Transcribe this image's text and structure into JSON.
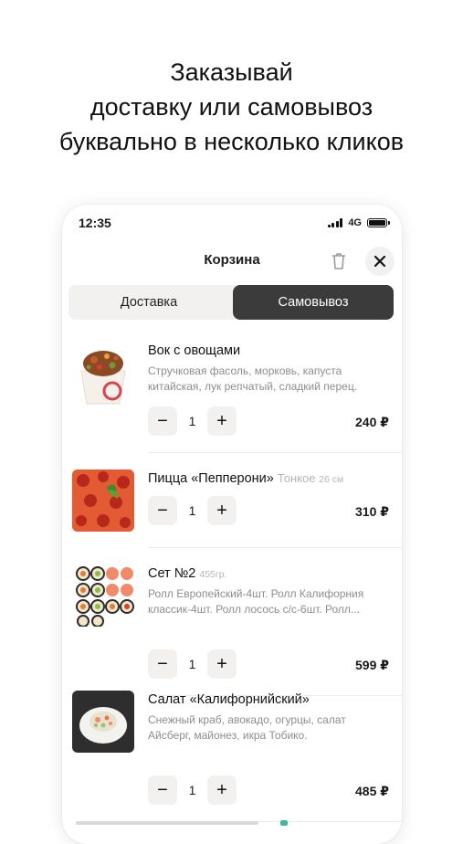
{
  "promo": {
    "line1": "Заказывай",
    "line2": "доставку или самовывоз",
    "line3": "буквально в несколько кликов"
  },
  "status_bar": {
    "time": "12:35",
    "network": "4G"
  },
  "header": {
    "title": "Корзина",
    "icons": [
      "trash-icon",
      "close-icon"
    ]
  },
  "segmented": {
    "delivery": "Доставка",
    "pickup": "Самовывоз",
    "selected": "pickup"
  },
  "cart": {
    "items": [
      {
        "name": "Вок с овощами",
        "extra": "",
        "extra_small": "",
        "desc": "Стручковая фасоль, морковь, капуста китайская, лук репчатый, сладкий перец.",
        "qty": "1",
        "price": "240 ₽"
      },
      {
        "name": "Пицца «Пепперони»",
        "extra": "Тонкое",
        "extra_small": "26 см",
        "desc": "",
        "qty": "1",
        "price": "310 ₽"
      },
      {
        "name": "Сет №2",
        "extra": "",
        "extra_small": "455гр.",
        "desc": "Ролл Европейский-4шт. Ролл Калифорния классик-4шт. Ролл лосось с/с-6шт. Ролл...",
        "qty": "1",
        "price": "599 ₽"
      },
      {
        "name": "Салат «Калифорнийский»",
        "extra": "",
        "extra_small": "",
        "desc": "Снежный краб, авокадо, огурцы, салат Айсберг, майонез, икра Тобико.",
        "qty": "1",
        "price": "485 ₽"
      }
    ]
  },
  "colors": {
    "segment_active": "#3b3b3b",
    "button_bg": "#f2f1ef",
    "desc_text": "#8d8d8d"
  }
}
